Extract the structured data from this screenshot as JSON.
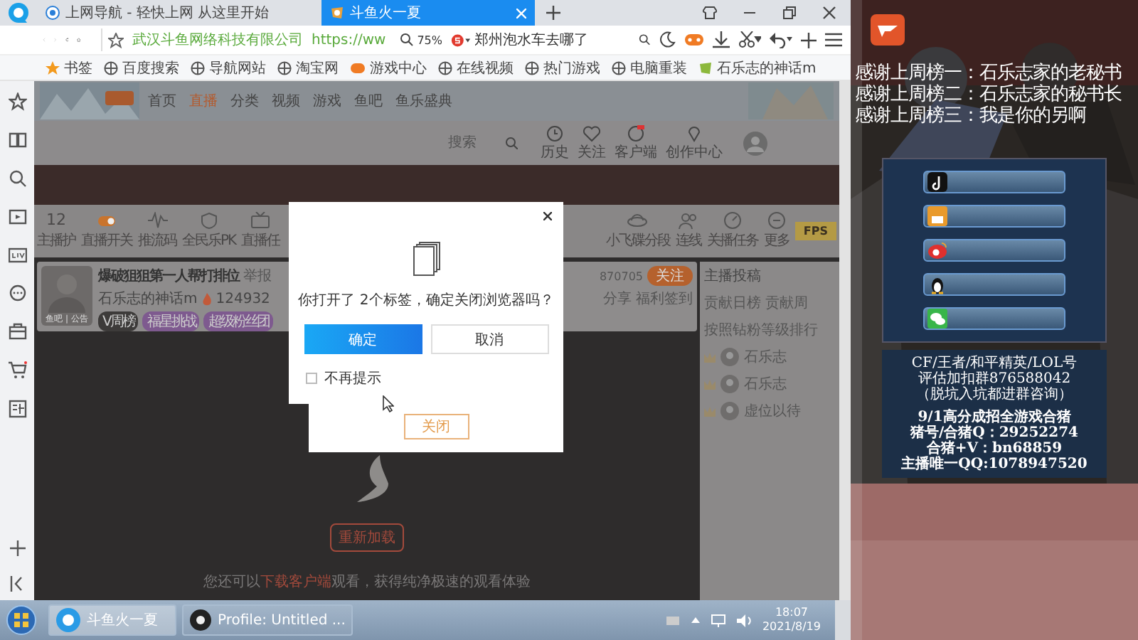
{
  "browser": {
    "tabs": [
      {
        "title": "上网导航 - 轻快上网 从这里开始",
        "selected": false
      },
      {
        "title": "斗鱼火一夏",
        "selected": true
      }
    ],
    "address": {
      "site_name": "武汉斗鱼网络科技有限公司",
      "url": "https://ww",
      "zoom": "75%",
      "search": "郑州泡水车去哪了"
    },
    "bookmarks": [
      "书签",
      "百度搜索",
      "导航网站",
      "淘宝网",
      "游戏中心",
      "在线视频",
      "热门游戏",
      "电脑重装",
      "石乐志的神话m"
    ]
  },
  "page": {
    "nav": [
      {
        "label": "首页",
        "selected": false
      },
      {
        "label": "直播",
        "selected": true
      },
      {
        "label": "分类",
        "selected": false
      },
      {
        "label": "视频",
        "selected": false
      },
      {
        "label": "游戏",
        "selected": false
      },
      {
        "label": "鱼吧",
        "selected": false
      },
      {
        "label": "鱼乐盛典",
        "selected": false
      }
    ],
    "search_placeholder": "搜索",
    "header_icons": [
      "历史",
      "关注",
      "客户端",
      "创作中心"
    ],
    "toolbar_left": [
      {
        "value": "12",
        "label": "主播护"
      },
      {
        "label": "直播开关"
      },
      {
        "label": "推流码"
      },
      {
        "label": "全民乐PK"
      },
      {
        "label": "直播任"
      }
    ],
    "toolbar_right": [
      {
        "label": "小飞碟分段"
      },
      {
        "label": "连线"
      },
      {
        "label": "关播任务"
      },
      {
        "label": "更多"
      }
    ],
    "fps": "FPS",
    "streamer": {
      "title": "爆破狙狙第一人帮打排位",
      "report": "举报",
      "name": "石乐志的神话m",
      "hot": "124932",
      "avatar_caption": "鱼吧 | 公告",
      "badges": [
        "V周榜",
        "福星挑战",
        "超级粉丝团"
      ],
      "followers": "870705",
      "follow": "关注",
      "share": "分享",
      "checkin": "福利签到"
    },
    "side": {
      "title": "主播投稿",
      "tabs": [
        "贡献日榜",
        "贡献周"
      ],
      "note": "按照钻粉等级排行",
      "ranks": [
        "石乐志",
        "石乐志",
        "虚位以待"
      ]
    },
    "video": {
      "reload": "重新加载",
      "tip": "您还可以",
      "tip_link": "下载客户端",
      "tip_end": "观看，获得纯净极速的观看体验"
    }
  },
  "dialog": {
    "message": "你打开了 2个标签，确定关闭浏览器吗？",
    "confirm": "确定",
    "cancel": "取消",
    "checkbox": {
      "label": "不再提示",
      "checked": false
    }
  },
  "back_dialog": {
    "close": "关闭"
  },
  "overlay": {
    "thanks": [
      "感谢上周榜一：石乐志家的老秘书",
      "感谢上周榜二：石乐志家的秘书长",
      "感谢上周榜三：我是你的另啊"
    ],
    "info": [
      "CF/王者/和平精英/LOL号",
      "评估加扣群876588042",
      "（脱坑入坑都进群咨询）"
    ],
    "info2": [
      "9/1高分成招全游戏合猪",
      "猪号/合猪Q：29252274",
      "合猪+V：bn68859",
      "主播唯一QQ:1078947520"
    ]
  },
  "taskbar": {
    "tasks": [
      {
        "title": "斗鱼火一夏",
        "selected": true
      },
      {
        "title": "Profile: Untitled ...",
        "selected": false
      }
    ],
    "time": "18:07",
    "date": "2021/8/19"
  }
}
